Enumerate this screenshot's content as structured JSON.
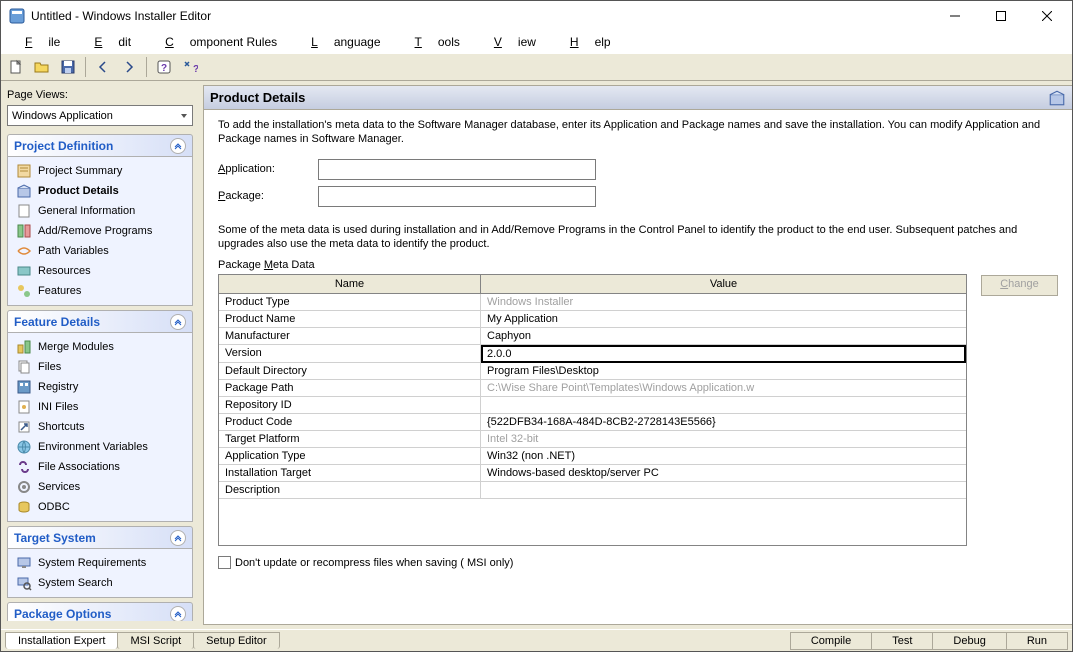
{
  "window": {
    "title": "Untitled - Windows Installer Editor"
  },
  "menubar": [
    {
      "u": "F",
      "r": "ile"
    },
    {
      "u": "E",
      "r": "dit"
    },
    {
      "u": "C",
      "r": "omponent Rules"
    },
    {
      "u": "L",
      "r": "anguage"
    },
    {
      "u": "T",
      "r": "ools"
    },
    {
      "u": "V",
      "r": "iew"
    },
    {
      "u": "H",
      "r": "elp"
    }
  ],
  "sidebar": {
    "page_views_label": "Page Views:",
    "dropdown_value": "Windows Application",
    "sections": [
      {
        "title": "Project Definition",
        "items": [
          "Project Summary",
          "Product Details",
          "General Information",
          "Add/Remove Programs",
          "Path Variables",
          "Resources",
          "Features"
        ]
      },
      {
        "title": "Feature Details",
        "items": [
          "Merge Modules",
          "Files",
          "Registry",
          "INI Files",
          "Shortcuts",
          "Environment Variables",
          "File Associations",
          "Services",
          "ODBC"
        ]
      },
      {
        "title": "Target System",
        "items": [
          "System Requirements",
          "System Search"
        ]
      },
      {
        "title": "Package Options",
        "items": []
      }
    ]
  },
  "main": {
    "title": "Product Details",
    "description": "To add the installation's meta data to the Software Manager database, enter its Application and Package names and save the installation. You can modify Application and Package names in Software Manager.",
    "application_u": "A",
    "application_r": "pplication:",
    "application_value": "",
    "package_u": "P",
    "package_r": "ackage:",
    "package_value": "",
    "meta_description": "Some of the meta data is used during installation and in Add/Remove Programs in the Control Panel to identify the product to the end user. Subsequent patches and upgrades also use the meta data to identify the product.",
    "meta_label_pre": "Package ",
    "meta_label_u": "M",
    "meta_label_post": "eta Data",
    "grid": {
      "headers": [
        "Name",
        "Value"
      ],
      "rows": [
        {
          "name": "Product Type",
          "value": "Windows Installer"
        },
        {
          "name": "Product Name",
          "value": "My Application"
        },
        {
          "name": "Manufacturer",
          "value": "Caphyon"
        },
        {
          "name": "Version",
          "value": "2.0.0"
        },
        {
          "name": "Default Directory",
          "value": "Program Files\\Desktop"
        },
        {
          "name": "Package Path",
          "value": "C:\\Wise Share Point\\Templates\\Windows Application.w"
        },
        {
          "name": "Repository ID",
          "value": ""
        },
        {
          "name": "Product Code",
          "value": "{522DFB34-168A-484D-8CB2-2728143E5566}"
        },
        {
          "name": "Target Platform",
          "value": "Intel 32-bit"
        },
        {
          "name": "Application Type",
          "value": "Win32 (non .NET)"
        },
        {
          "name": "Installation Target",
          "value": "Windows-based desktop/server PC"
        },
        {
          "name": "Description",
          "value": ""
        }
      ]
    },
    "change_u": "C",
    "change_r": "hange",
    "checkbox_label": "Don't update or recompress files when saving ( MSI only)"
  },
  "bottom": {
    "tabs": [
      "Installation Expert",
      "MSI Script",
      "Setup Editor"
    ],
    "actions": [
      "Compile",
      "Test",
      "Debug",
      "Run"
    ]
  }
}
